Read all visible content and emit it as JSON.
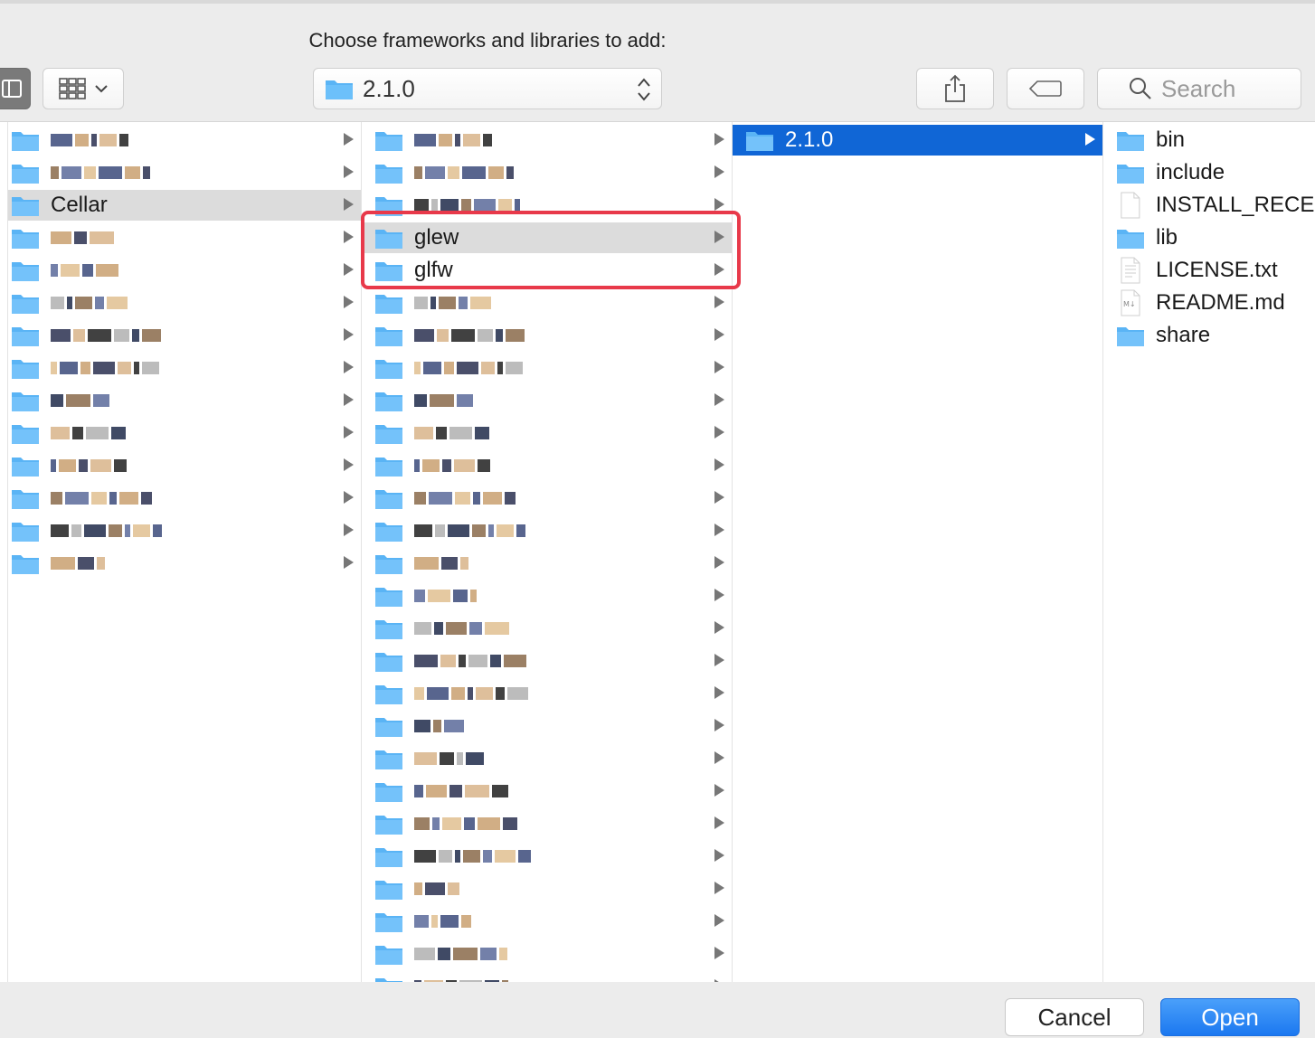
{
  "dialog": {
    "title": "Choose frameworks and libraries to add:"
  },
  "toolbar": {
    "path_label": "2.1.0",
    "search_placeholder": "Search"
  },
  "columns": {
    "col1": {
      "items": [
        {
          "name": "",
          "redacted": true,
          "arrow": true
        },
        {
          "name": "",
          "redacted": true,
          "arrow": true
        },
        {
          "name": "Cellar",
          "redacted": false,
          "arrow": true,
          "selected": "gray"
        },
        {
          "name": "",
          "redacted": true,
          "arrow": true
        },
        {
          "name": "",
          "redacted": true,
          "arrow": true
        },
        {
          "name": "",
          "redacted": true,
          "arrow": true
        },
        {
          "name": "",
          "redacted": true,
          "arrow": true
        },
        {
          "name": "",
          "redacted": true,
          "arrow": true
        },
        {
          "name": "",
          "redacted": true,
          "arrow": true
        },
        {
          "name": "",
          "redacted": true,
          "arrow": true
        },
        {
          "name": "",
          "redacted": true,
          "arrow": true
        },
        {
          "name": "",
          "redacted": true,
          "arrow": true
        },
        {
          "name": "",
          "redacted": true,
          "arrow": true
        },
        {
          "name": "",
          "redacted": true,
          "arrow": true
        }
      ]
    },
    "col2": {
      "items": [
        {
          "name": "",
          "redacted": true,
          "arrow": true
        },
        {
          "name": "",
          "redacted": true,
          "arrow": true
        },
        {
          "name": "",
          "redacted": true,
          "arrow": true
        },
        {
          "name": "glew",
          "redacted": false,
          "arrow": true,
          "selected": "gray"
        },
        {
          "name": "glfw",
          "redacted": false,
          "arrow": true
        },
        {
          "name": "",
          "redacted": true,
          "arrow": true
        },
        {
          "name": "",
          "redacted": true,
          "arrow": true
        },
        {
          "name": "",
          "redacted": true,
          "arrow": true
        },
        {
          "name": "",
          "redacted": true,
          "arrow": true
        },
        {
          "name": "",
          "redacted": true,
          "arrow": true
        },
        {
          "name": "",
          "redacted": true,
          "arrow": true
        },
        {
          "name": "",
          "redacted": true,
          "arrow": true
        },
        {
          "name": "",
          "redacted": true,
          "arrow": true
        },
        {
          "name": "",
          "redacted": true,
          "arrow": true
        },
        {
          "name": "",
          "redacted": true,
          "arrow": true
        },
        {
          "name": "",
          "redacted": true,
          "arrow": true
        },
        {
          "name": "",
          "redacted": true,
          "arrow": true
        },
        {
          "name": "",
          "redacted": true,
          "arrow": true
        },
        {
          "name": "",
          "redacted": true,
          "arrow": true
        },
        {
          "name": "",
          "redacted": true,
          "arrow": true
        },
        {
          "name": "",
          "redacted": true,
          "arrow": true
        },
        {
          "name": "",
          "redacted": true,
          "arrow": true
        },
        {
          "name": "",
          "redacted": true,
          "arrow": true
        },
        {
          "name": "",
          "redacted": true,
          "arrow": true
        },
        {
          "name": "",
          "redacted": true,
          "arrow": true
        },
        {
          "name": "",
          "redacted": true,
          "arrow": true
        },
        {
          "name": "",
          "redacted": true,
          "arrow": true
        }
      ]
    },
    "col3": {
      "items": [
        {
          "name": "2.1.0",
          "arrow": true,
          "selected": "blue"
        }
      ]
    },
    "col4": {
      "items": [
        {
          "name": "bin",
          "kind": "folder"
        },
        {
          "name": "include",
          "kind": "folder"
        },
        {
          "name": "INSTALL_RECEI",
          "kind": "file"
        },
        {
          "name": "lib",
          "kind": "folder"
        },
        {
          "name": "LICENSE.txt",
          "kind": "text-file"
        },
        {
          "name": "README.md",
          "kind": "markdown-file"
        },
        {
          "name": "share",
          "kind": "folder"
        }
      ]
    }
  },
  "buttons": {
    "cancel": "Cancel",
    "open": "Open"
  },
  "colors": {
    "selection_blue": "#1066d6",
    "highlight_red": "#e8394a",
    "folder_blue": "#5ab4f5"
  }
}
